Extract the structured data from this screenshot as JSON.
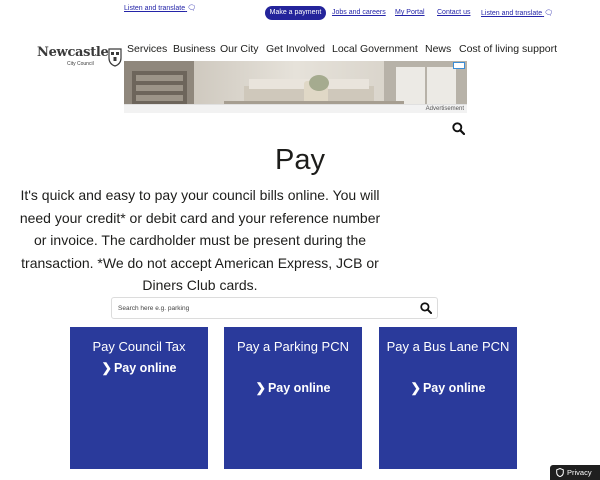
{
  "utility_bar": {
    "listen_left": "Listen and translate",
    "make_payment": "Make a payment",
    "jobs": "Jobs and careers",
    "portal": "My Portal",
    "contact": "Contact us",
    "listen_right": "Listen and translate"
  },
  "logo": {
    "name": "Newcastle",
    "subtitle": "City Council"
  },
  "nav": [
    "Services",
    "Business",
    "Our City",
    "Get Involved",
    "Local Government",
    "News",
    "Cost of living support"
  ],
  "ad": {
    "label": "Advertisement"
  },
  "page": {
    "title": "Pay",
    "intro": "It's quick and easy to pay your council bills online. You will need your credit* or debit card and your reference number or invoice. The cardholder must be present during the transaction. *We do not accept American Express, JCB or Diners Club cards."
  },
  "search": {
    "placeholder": "Search here e.g. parking"
  },
  "cards": [
    {
      "title": "Pay Council Tax",
      "link": "Pay online"
    },
    {
      "title": "Pay a Parking PCN",
      "link": "Pay online"
    },
    {
      "title": "Pay a Bus Lane PCN",
      "link": "Pay online"
    }
  ],
  "privacy": {
    "label": "Privacy"
  },
  "colors": {
    "brand_blue": "#2a3a9b",
    "link_blue": "#2424a8",
    "button_blue": "#24249b"
  },
  "icons": [
    "speaker-icon",
    "crest-icon",
    "search-icon",
    "chevron-right-icon",
    "shield-icon",
    "adchoices-icon"
  ]
}
